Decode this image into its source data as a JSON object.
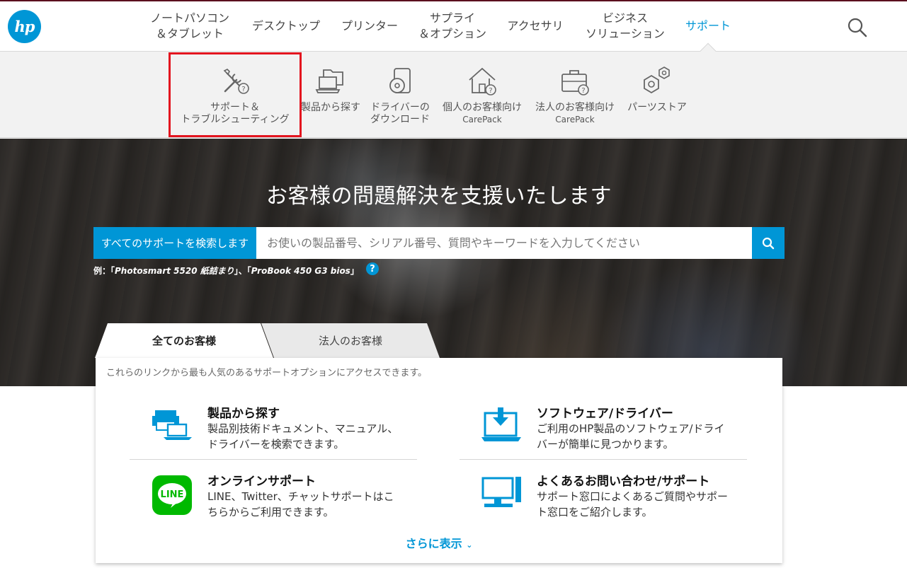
{
  "header": {
    "logo_text": "hp",
    "nav": [
      {
        "label": "ノートパソコン\n＆タブレット"
      },
      {
        "label": "デスクトップ"
      },
      {
        "label": "プリンター"
      },
      {
        "label": "サプライ\n＆オプション"
      },
      {
        "label": "アクセサリ"
      },
      {
        "label": "ビジネス\nソリューション"
      },
      {
        "label": "サポート",
        "active": true
      }
    ],
    "search_icon": "search-icon"
  },
  "submenu": {
    "items": [
      {
        "label": "サポート＆\nトラブルシューティング",
        "icon": "tools-question-icon"
      },
      {
        "label": "製品から探す",
        "icon": "laptop-folder-icon"
      },
      {
        "label": "ドライバーの\nダウンロード",
        "icon": "driver-disc-icon"
      },
      {
        "label": "個人のお客様向け",
        "sub": "CarePack",
        "icon": "house-question-icon"
      },
      {
        "label": "法人のお客様向け",
        "sub": "CarePack",
        "icon": "briefcase-question-icon"
      },
      {
        "label": "パーツストア",
        "icon": "hex-nuts-icon"
      }
    ]
  },
  "hero": {
    "title": "お客様の問題解決を支援いたします",
    "search_label": "すべてのサポートを検索します",
    "search_placeholder": "お使いの製品番号、シリアル番号、質問やキーワードを入力してください",
    "example_prefix": "例：「",
    "example_1": "Photosmart 5520 紙詰まり",
    "example_sep": "」、「",
    "example_2": "ProBook 450 G3 bios",
    "example_suffix": "」",
    "help": "?"
  },
  "tabs": [
    {
      "label": "全てのお客様",
      "active": true
    },
    {
      "label": "法人のお客様",
      "active": false
    }
  ],
  "card": {
    "intro": "これらのリンクから最も人気のあるサポートオプションにアクセスできます。",
    "options": [
      {
        "title": "製品から探す",
        "desc": "製品別技術ドキュメント、マニュアル、ドライバーを検索できます。",
        "icon": "printer-laptop-icon"
      },
      {
        "title": "ソフトウェア/ドライバー",
        "desc": "ご利用のHP製品のソフトウェア/ドライバーが簡単に見つかります。",
        "icon": "download-laptop-icon"
      },
      {
        "title": "オンラインサポート",
        "desc": "LINE、Twitter、チャットサポートはこちらからご利用できます。",
        "icon": "line-app-icon"
      },
      {
        "title": "よくあるお問い合わせ/サポート",
        "desc": "サポート窓口によくあるご質問やサポート窓口をご紹介します。",
        "icon": "desktop-pc-icon"
      }
    ],
    "more": "さらに表示"
  },
  "colors": {
    "accent": "#0096d6",
    "highlight": "#e3141f",
    "line_green": "#00b900"
  }
}
